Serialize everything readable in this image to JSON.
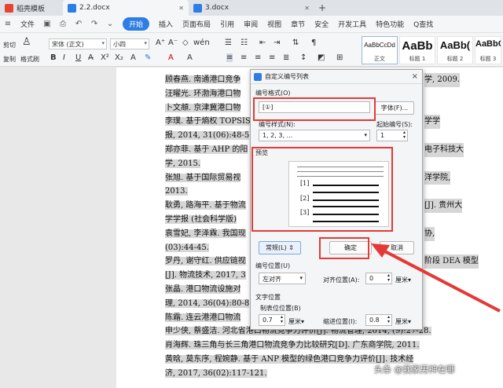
{
  "tabs": [
    {
      "label": "稻壳模板",
      "color": "#e8432e"
    },
    {
      "label": "2.2.docx",
      "color": "#2d7de4"
    },
    {
      "label": "3.docx",
      "color": "#2d7de4"
    }
  ],
  "menu": {
    "file": "文件",
    "start": "开始",
    "items": [
      "插入",
      "页面布局",
      "引用",
      "审阅",
      "视图",
      "章节",
      "安全",
      "开发工具",
      "特色功能"
    ],
    "search": "Q查找"
  },
  "toolbar": {
    "cut": "剪切",
    "copy": "复制",
    "format_painter": "格式刷",
    "font_name": "宋体 (正文)",
    "font_size": "小四",
    "bold": "B",
    "italic": "I",
    "underline": "U"
  },
  "styles": [
    {
      "preview": "AaBbCcDd",
      "label": "正文"
    },
    {
      "preview": "AaBb",
      "label": "标题 1"
    },
    {
      "preview": "AaBb(",
      "label": "标题 2"
    },
    {
      "preview": "AaBbC",
      "label": "标题 3"
    }
  ],
  "document": {
    "lines": [
      {
        "left": "顾春燕. 南通港口竞争",
        "right": "学, 2009."
      },
      {
        "left": "汪曜光. 环渤海港口物",
        "right": ""
      },
      {
        "left": "卜文頫. 京津冀港口物",
        "right": ""
      },
      {
        "left": "李璞. 基于熵权 TOPSIS",
        "right": "学学"
      },
      {
        "left": "报, 2014, 31(06):48-5",
        "right": ""
      },
      {
        "left": "郑亦菲. 基于 AHP 的阳",
        "right": "电子科技大"
      },
      {
        "left": "学, 2015.",
        "right": ""
      },
      {
        "left": "张旭. 基于国际贸易视",
        "right": "洋学院,"
      },
      {
        "left": "2013.",
        "right": ""
      },
      {
        "left": "耿勇, 路海平. 基于物流",
        "right": "[J]. 贵州大"
      },
      {
        "left": "学学报 (社会科学版)",
        "right": ""
      },
      {
        "left": "袁雪妃, 李泽霖. 我国现",
        "right": "协,"
      },
      {
        "left": "(03):44-45.",
        "right": ""
      },
      {
        "left": "罗丹, 谢守红. 供应链视",
        "right": "阶段 DEA 模型"
      },
      {
        "left": "[J]. 物流技术, 2017, 3",
        "right": ""
      },
      {
        "left": "张晶. 港口物流设施对",
        "right": ""
      },
      {
        "left": "理, 2014, 36(04):80-8",
        "right": ""
      },
      {
        "left": "陈霜. 连云港港口物流",
        "right": ""
      },
      {
        "left": "申少侠, 蔡盛洁. 河北省港口物流竞争力评价[J]. 物流管理, 2014, (9):27-28.",
        "right": ""
      },
      {
        "left": "肖海辉. 珠三角与长三角港口物流竞争力比较研究[D]. 广东商学院, 2011.",
        "right": ""
      },
      {
        "left": "黄晗, 莫东序, 程婉静. 基于 ANP 模型的绿色港口竞争力评价[J]. 技术经",
        "right": ""
      },
      {
        "left": "济, 2017, 36(02):117-121.",
        "right": ""
      }
    ]
  },
  "dialog": {
    "title": "自定义编号列表",
    "close": "×",
    "format_label": "编号格式(O)",
    "format_value": "[①]",
    "font_button": "字体(F)...",
    "style_label": "编号样式(N):",
    "style_value": "1, 2, 3, ...",
    "start_label": "起始编号(S):",
    "start_value": "1",
    "preview_label": "预览",
    "preview_numbers": [
      "[1]",
      "[2]",
      "[3]"
    ],
    "normal_button": "常规(L) ⇕",
    "ok_button": "确定",
    "cancel_button": "取消",
    "position_label": "编号位置(U)",
    "align_value": "左对齐",
    "align_pos_label": "对齐位置(A):",
    "align_pos_value": "0",
    "unit_cm": "厘米▾",
    "text_position_label": "文字位置",
    "tab_pos_label": "制表位位置(B)",
    "tab_pos_value": "0.7",
    "indent_label": "缩进位置(I):",
    "indent_value": "0.8"
  },
  "watermark": "头条 @我家男神在哪",
  "colors": {
    "accent": "#2d7de4",
    "callout": "#e53935"
  }
}
